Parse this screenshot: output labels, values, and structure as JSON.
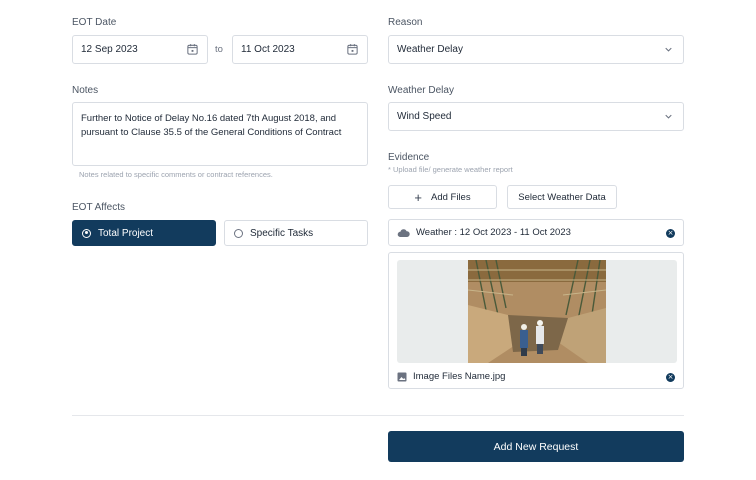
{
  "eot": {
    "label": "EOT Date",
    "start": "12 Sep 2023",
    "to": "to",
    "end": "11 Oct 2023"
  },
  "reason": {
    "label": "Reason",
    "value": "Weather Delay"
  },
  "notes": {
    "label": "Notes",
    "line1": "Further to Notice of Delay No.16 dated 7th August 2018, and",
    "line2": "pursuant to Clause 35.5 of the General Conditions of Contract",
    "hint": "Notes related to specific comments or contract references."
  },
  "weather_delay": {
    "label": "Weather Delay",
    "value": "Wind Speed"
  },
  "evidence": {
    "label": "Evidence",
    "hint": "* Upload file/ generate weather report",
    "add_files": "Add Files",
    "select_weather": "Select Weather Data",
    "weather_chip": "Weather : 12 Oct 2023 - 11 Oct 2023",
    "image_name": "Image Files Name.jpg"
  },
  "affects": {
    "label": "EOT Affects",
    "options": [
      "Total Project",
      "Specific Tasks"
    ],
    "selected": "Total Project"
  },
  "submit_label": "Add New Request",
  "colors": {
    "primary": "#123b5d",
    "border": "#d9dde3"
  },
  "icons": [
    "calendar-icon",
    "chevron-down-icon",
    "plus-icon",
    "cloud-icon",
    "close-circle-icon",
    "image-icon"
  ]
}
